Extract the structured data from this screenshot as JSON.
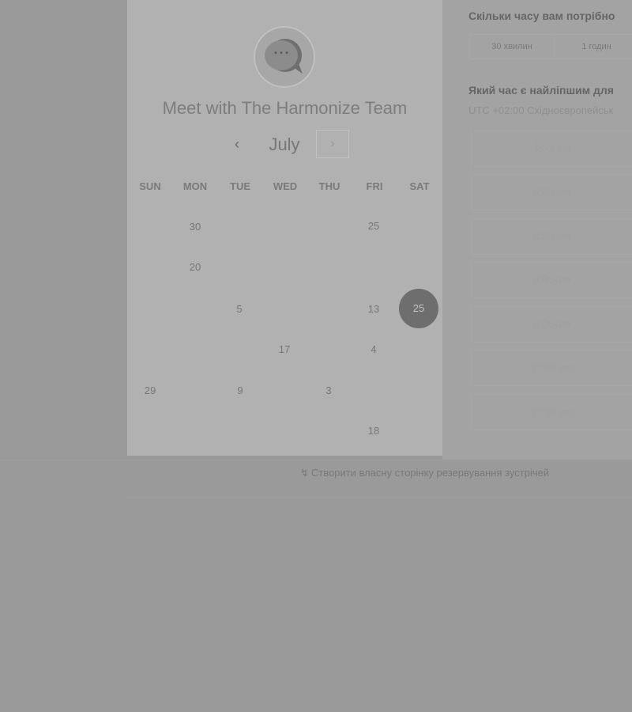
{
  "meeting": {
    "title": "Meet with The Harmonize Team"
  },
  "calendar": {
    "month": "July",
    "prev_icon": "‹",
    "next_icon": "›",
    "weekdays": [
      "SUN",
      "MON",
      "TUE",
      "WED",
      "THU",
      "FRI",
      "SAT"
    ],
    "days": [
      {
        "label": "30"
      },
      {
        "label": "25"
      },
      {
        "label": "20"
      },
      {
        "label": "5"
      },
      {
        "label": "13"
      },
      {
        "label": "25",
        "selected": true
      },
      {
        "label": "17"
      },
      {
        "label": "4"
      },
      {
        "label": "29"
      },
      {
        "label": "9"
      },
      {
        "label": "3"
      },
      {
        "label": "18"
      }
    ]
  },
  "duration": {
    "question": "Скільки часу вам потрібно",
    "options": [
      "30 хвилин",
      "1 годин"
    ]
  },
  "time": {
    "question": "Який час є найліпшим для",
    "timezone": "UTC +02:00 Східноєвропейськ",
    "slots": [
      "7:30 am",
      "8:00 am",
      "8:30 am",
      "9:00 am",
      "9:30 am",
      "10:00 am",
      "10:30 am"
    ]
  },
  "footer": {
    "link_text": "Створити власну сторінку резервування зустрічей",
    "icon": "hubspot-sprocket-icon"
  },
  "colors": {
    "overlay": "#9a9a9a",
    "selected_day": "#6e6e6e"
  }
}
